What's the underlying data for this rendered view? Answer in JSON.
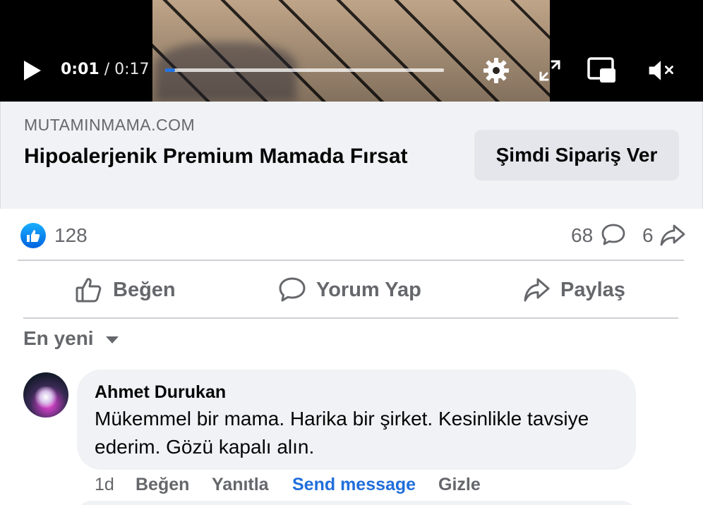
{
  "video": {
    "current_time": "0:01",
    "separator": " / ",
    "total_time": "0:17",
    "progress_fraction": 0.035,
    "icons": [
      "play-icon",
      "settings-gear-icon",
      "fullscreen-icon",
      "picture-in-picture-icon",
      "volume-muted-icon"
    ]
  },
  "link_card": {
    "domain": "MUTAMINMAMA.COM",
    "title": "Hipoalerjenik Premium Mamada Fırsat",
    "cta_label": "Şimdi Sipariş Ver"
  },
  "reactions": {
    "like_count": "128",
    "comment_count": "68",
    "share_count": "6"
  },
  "actions": {
    "like": "Beğen",
    "comment": "Yorum Yap",
    "share": "Paylaş"
  },
  "comments_sort": {
    "label": "En yeni"
  },
  "comment": {
    "author": "Ahmet Durukan",
    "text": "Mükemmel bir mama. Harika bir şirket. Kesinlikle tavsiye ederim. Gözü kapalı alın.",
    "time": "1d",
    "like": "Beğen",
    "reply": "Yanıtla",
    "send_message": "Send message",
    "hide": "Gizle"
  },
  "colors": {
    "accent_blue": "#216fdb",
    "progress_blue": "#2374e1",
    "muted_text": "#65676b",
    "card_bg": "#f0f2f5"
  }
}
